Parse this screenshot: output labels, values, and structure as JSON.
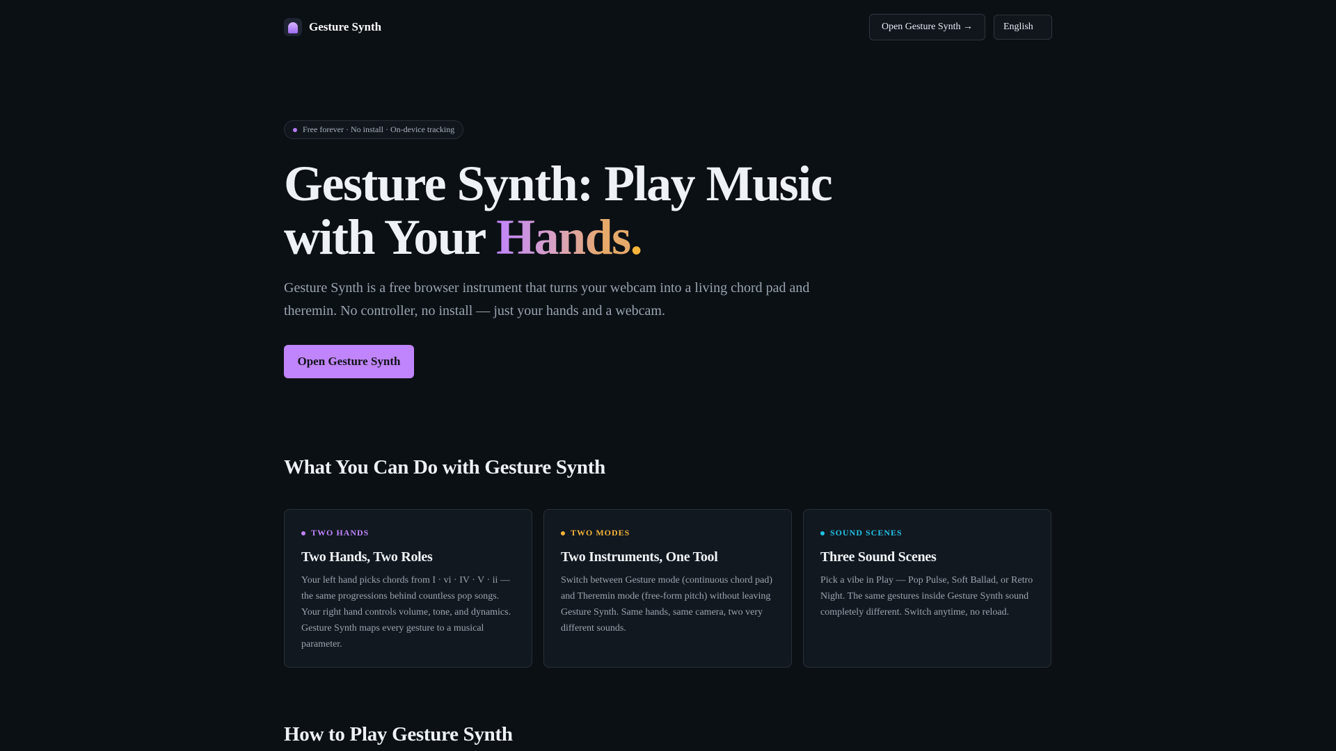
{
  "header": {
    "brand": "Gesture Synth",
    "open_button": "Open Gesture Synth →",
    "language": "English"
  },
  "hero": {
    "badge": "Free forever · No install · On-device tracking",
    "title_part1": "Gesture Synth: Play Music with Your ",
    "title_highlight": "Hands",
    "title_period": ".",
    "subtitle": "Gesture Synth is a free browser instrument that turns your webcam into a living chord pad and theremin. No controller, no install — just your hands and a webcam.",
    "cta": "Open Gesture Synth"
  },
  "features": {
    "title": "What You Can Do with Gesture Synth",
    "cards": [
      {
        "tag": "TWO HANDS",
        "tag_color": "#c084fc",
        "title": "Two Hands, Two Roles",
        "body": "Your left hand picks chords from I · vi · IV · V · ii — the same progressions behind countless pop songs. Your right hand controls volume, tone, and dynamics. Gesture Synth maps every gesture to a musical parameter."
      },
      {
        "tag": "TWO MODES",
        "tag_color": "#f5b43a",
        "title": "Two Instruments, One Tool",
        "body": "Switch between Gesture mode (continuous chord pad) and Theremin mode (free-form pitch) without leaving Gesture Synth. Same hands, same camera, two very different sounds."
      },
      {
        "tag": "SOUND SCENES",
        "tag_color": "#22c3e6",
        "title": "Three Sound Scenes",
        "body": "Pick a vibe in Play — Pop Pulse, Soft Ballad, or Retro Night. The same gestures inside Gesture Synth sound completely different. Switch anytime, no reload."
      }
    ]
  },
  "howto": {
    "title": "How to Play Gesture Synth"
  }
}
